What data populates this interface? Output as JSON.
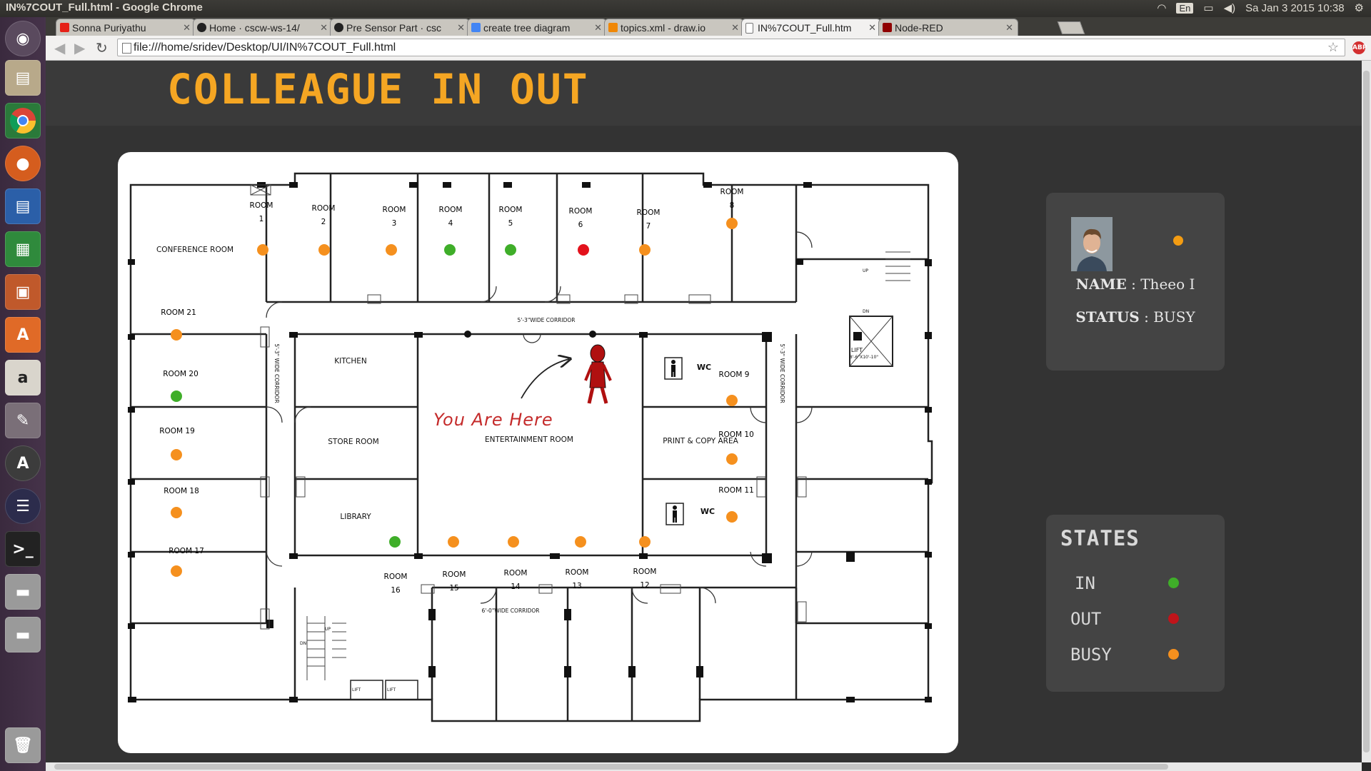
{
  "topbar": {
    "window_title": "IN%7COUT_Full.html - Google Chrome",
    "keyboard": "En",
    "clock": "Sa Jan 3 2015 10:38"
  },
  "tabs": [
    {
      "label": "Sonna Puriyathu",
      "fav_color": "#e62117"
    },
    {
      "label": "Home · cscw-ws-14/",
      "fav_color": "#222222"
    },
    {
      "label": "Pre Sensor Part · csc",
      "fav_color": "#222222"
    },
    {
      "label": "create tree diagram",
      "fav_color": "#4285f4"
    },
    {
      "label": "topics.xml - draw.io",
      "fav_color": "#f08705"
    },
    {
      "label": "IN%7COUT_Full.htm",
      "fav_color": "#ffffff"
    },
    {
      "label": "Node-RED",
      "fav_color": "#8f0000"
    }
  ],
  "address": {
    "url": "file:///home/sridev/Desktop/UI/IN%7COUT_Full.html"
  },
  "page": {
    "title": "COLLEAGUE IN OUT"
  },
  "floorplan": {
    "conference": "CONFERENCE ROOM",
    "corridor_top": "5'-3\"WIDE CORRIDOR",
    "corridor_bottom": "6'-0\"WIDE CORRIDOR",
    "corridor_left": "5'-3\" WIDE CORRIDOR",
    "corridor_right": "5'-3\" WIDE CORRIDOR",
    "kitchen": "KITCHEN",
    "store": "STORE ROOM",
    "library": "LIBRARY",
    "entertainment": "ENTERTAINMENT ROOM",
    "print": "PRINT & COPY AREA",
    "wc1": "WC",
    "wc2": "WC",
    "you_are_here": "You Are Here",
    "lift": "LIFT",
    "lift_size": "8'-6\"X10'-10\"",
    "up": "UP",
    "dn": "DN",
    "lift_small_1": "LIFT",
    "lift_small_2": "LIFT",
    "rooms": [
      {
        "word": "ROOM",
        "num": "1",
        "status": "busy"
      },
      {
        "word": "ROOM",
        "num": "2",
        "status": "busy"
      },
      {
        "word": "ROOM",
        "num": "3",
        "status": "busy"
      },
      {
        "word": "ROOM",
        "num": "4",
        "status": "in"
      },
      {
        "word": "ROOM",
        "num": "5",
        "status": "in"
      },
      {
        "word": "ROOM",
        "num": "6",
        "status": "out"
      },
      {
        "word": "ROOM",
        "num": "7",
        "status": "busy"
      },
      {
        "word": "ROOM",
        "num": "8",
        "status": "busy"
      },
      {
        "label": "ROOM 9",
        "status": "busy"
      },
      {
        "label": "ROOM 10",
        "status": "busy"
      },
      {
        "label": "ROOM 11",
        "status": "busy"
      },
      {
        "word": "ROOM",
        "num": "12",
        "status": "busy"
      },
      {
        "word": "ROOM",
        "num": "13",
        "status": "busy"
      },
      {
        "word": "ROOM",
        "num": "14",
        "status": "busy"
      },
      {
        "word": "ROOM",
        "num": "15",
        "status": "busy"
      },
      {
        "word": "ROOM",
        "num": "16",
        "status": "in"
      },
      {
        "label": "ROOM 17",
        "status": "busy"
      },
      {
        "label": "ROOM 18",
        "status": "busy"
      },
      {
        "label": "ROOM 19",
        "status": "busy"
      },
      {
        "label": "ROOM 20",
        "status": "in"
      },
      {
        "label": "ROOM 21",
        "status": "busy"
      }
    ]
  },
  "profile": {
    "name_label": "NAME",
    "name_value": "Theeo I",
    "status_label": "STATUS",
    "status_value": "BUSY",
    "status_color": "#f39c12"
  },
  "states": {
    "title": "STATES",
    "items": [
      {
        "label": "IN",
        "color": "#3fae29"
      },
      {
        "label": "OUT",
        "color": "#c0141a"
      },
      {
        "label": "BUSY",
        "color": "#f5901e"
      }
    ]
  },
  "colors": {
    "title": "#f5a623",
    "in": "#3fae29",
    "out": "#e3121c",
    "busy": "#f5901e"
  }
}
